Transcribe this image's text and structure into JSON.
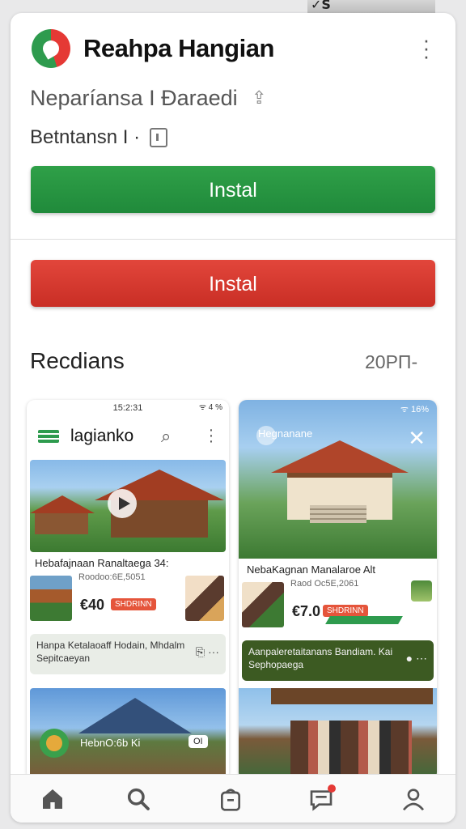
{
  "app": {
    "title": "Reahpa Hangian",
    "subtitle": "Neparíansa I Đaraedi",
    "meta": "Betntansn I ·"
  },
  "buttons": {
    "primary": "Instal",
    "secondary": "Instal"
  },
  "section": {
    "title": "Recdians",
    "right": "20PП-"
  },
  "screenshots": [
    {
      "status_time": "15:2:31",
      "status_right": "ᯤ 4 %",
      "header_title": "lagianko",
      "caption": "Hebafajnaan Ranaltaega 34:",
      "date": "Roodoo:6E,5051",
      "price": "€40",
      "badge": "SHDRINN",
      "info": "Hanpa Ketalaoaff Hodain, Mhdalm Sepitcaeyan",
      "bottom_label": "HebnO:6b Ki",
      "bottom_chip": "OI"
    },
    {
      "status_right": "ᯤ 16%",
      "brand": "Hegnanane",
      "caption": "NebaKagnan Manalaroe Alt",
      "date": "Raod Oc5E,2061",
      "price": "€7.0",
      "badge": "SHDRINN",
      "info": "Aanpaleretaitanans Bandiam. Kai Sephopaega"
    }
  ],
  "colors": {
    "accent_green": "#2fa048",
    "accent_red": "#e2463b"
  },
  "nav": [
    "home",
    "search",
    "shop",
    "chat",
    "profile"
  ]
}
